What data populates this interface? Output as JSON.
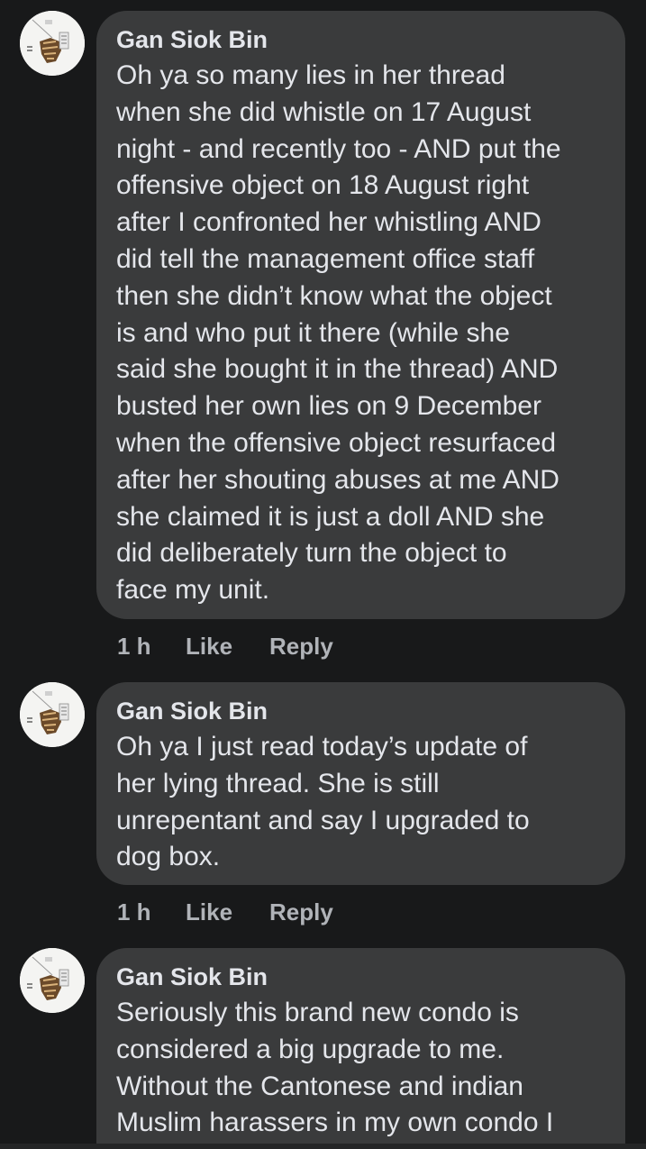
{
  "comments": [
    {
      "author": "Gan Siok Bin",
      "lines": [
        "Oh ya so many lies in her thread",
        "when she did whistle on 17 August",
        "night - and recently too - AND put the",
        "offensive object on 18 August right",
        "after I confronted her whistling AND",
        "did tell the management office staff",
        "then she didn’t know what the object",
        "is and who put it there (while she",
        "said she bought it in the thread) AND",
        "busted her own lies on 9 December",
        "when the offensive object resurfaced",
        "after her shouting abuses at me AND",
        "she claimed it is just a doll AND she",
        "did deliberately turn the object to",
        "face my unit."
      ],
      "time": "1 h",
      "like_label": "Like",
      "reply_label": "Reply"
    },
    {
      "author": "Gan Siok Bin",
      "lines": [
        "Oh ya I just read today’s update of",
        "her lying thread. She is still",
        "unrepentant and say I upgraded to",
        "dog box."
      ],
      "time": "1 h",
      "like_label": "Like",
      "reply_label": "Reply"
    },
    {
      "author": "Gan Siok Bin",
      "lines": [
        "Seriously this brand new condo is",
        "considered a big upgrade to me.",
        "Without the Cantonese and indian",
        "Muslim harassers in my own condo I"
      ]
    }
  ],
  "colors": {
    "background": "#18191a",
    "bubble": "#3a3b3c",
    "text": "#e4e6eb",
    "secondary_text": "#b0b3b8"
  },
  "icons": {
    "avatar": "profile-picture-icon"
  }
}
